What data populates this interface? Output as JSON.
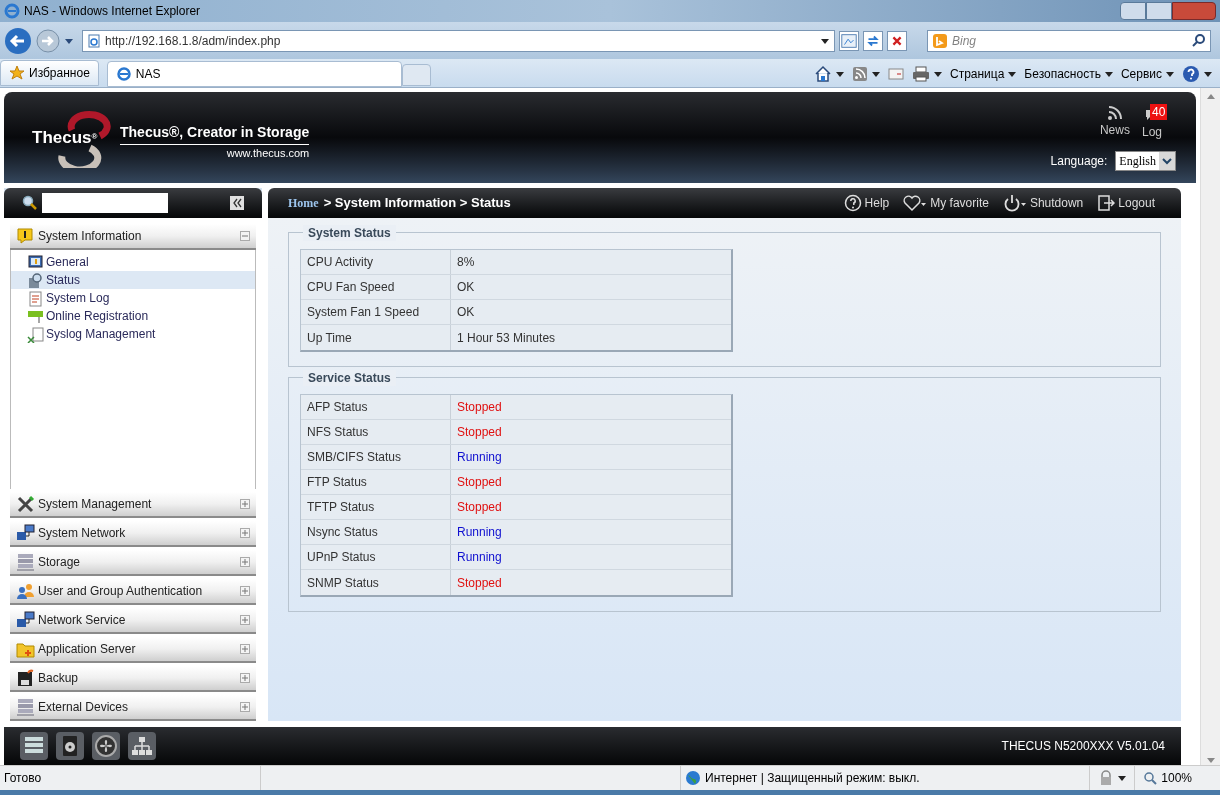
{
  "browser": {
    "title": "NAS - Windows Internet Explorer",
    "address": "http://192.168.1.8/adm/index.php",
    "search_placeholder": "Bing",
    "favorites": "Избранное",
    "tabs": [
      {
        "label": "NAS",
        "selected": true
      }
    ],
    "commands": [
      "Страница",
      "Безопасность",
      "Сервис"
    ]
  },
  "header": {
    "brand": "Thecus",
    "brand_mark": "®",
    "tagline": "Thecus®, Creator in Storage",
    "website": "www.thecus.com",
    "news": "News",
    "log": "Log",
    "log_count": "40",
    "language_label": "Language:",
    "language": "English"
  },
  "breadcrumb": {
    "link": "Home",
    "trail": "> System Information > Status"
  },
  "actions": [
    {
      "kind": "help",
      "label": "Help"
    },
    {
      "kind": "favorite",
      "label": "My favorite"
    },
    {
      "kind": "power",
      "label": "Shutdown"
    },
    {
      "kind": "logout",
      "label": "Logout"
    }
  ],
  "sidebar": {
    "groups": [
      {
        "label": "System Information",
        "expanded": true,
        "children": [
          {
            "label": "General",
            "selected": false
          },
          {
            "label": "Status",
            "selected": true
          },
          {
            "label": "System Log",
            "selected": false
          },
          {
            "label": "Online Registration",
            "selected": false
          },
          {
            "label": "Syslog Management",
            "selected": false
          }
        ]
      },
      {
        "label": "System Management",
        "expanded": false
      },
      {
        "label": "System Network",
        "expanded": false
      },
      {
        "label": "Storage",
        "expanded": false
      },
      {
        "label": "User and Group Authentication",
        "expanded": false
      },
      {
        "label": "Network Service",
        "expanded": false
      },
      {
        "label": "Application Server",
        "expanded": false
      },
      {
        "label": "Backup",
        "expanded": false
      },
      {
        "label": "External Devices",
        "expanded": false
      }
    ]
  },
  "sections": [
    {
      "title": "System Status",
      "rows": [
        {
          "label": "CPU Activity",
          "value": "8%"
        },
        {
          "label": "CPU Fan Speed",
          "value": "OK"
        },
        {
          "label": "System Fan 1 Speed",
          "value": "OK"
        },
        {
          "label": "Up Time",
          "value": "1 Hour 53 Minutes"
        }
      ]
    },
    {
      "title": "Service Status",
      "rows": [
        {
          "label": "AFP Status",
          "value": "Stopped",
          "color": "#e01010"
        },
        {
          "label": "NFS Status",
          "value": "Stopped",
          "color": "#e01010"
        },
        {
          "label": "SMB/CIFS Status",
          "value": "Running",
          "color": "#1010d0"
        },
        {
          "label": "FTP Status",
          "value": "Stopped",
          "color": "#e01010"
        },
        {
          "label": "TFTP Status",
          "value": "Stopped",
          "color": "#e01010"
        },
        {
          "label": "Nsync Status",
          "value": "Running",
          "color": "#1010d0"
        },
        {
          "label": "UPnP Status",
          "value": "Running",
          "color": "#1010d0"
        },
        {
          "label": "SNMP Status",
          "value": "Stopped",
          "color": "#e01010"
        }
      ]
    }
  ],
  "footer": {
    "version": "THECUS N5200XXX V5.01.04"
  },
  "status_bar": {
    "text": "Готово",
    "zone": "Интернет | Защищенный режим: выкл.",
    "zoom": "100%"
  }
}
